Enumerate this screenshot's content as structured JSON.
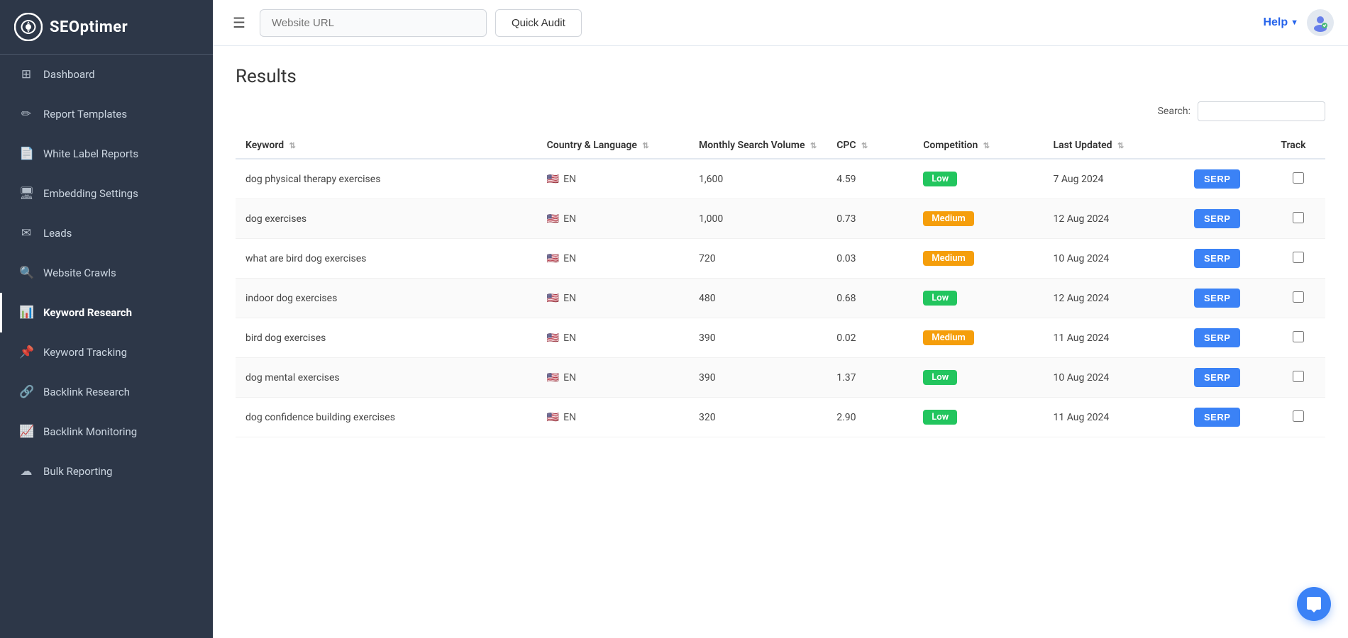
{
  "sidebar": {
    "logo_text": "SEOptimer",
    "items": [
      {
        "id": "dashboard",
        "label": "Dashboard",
        "icon": "⊞",
        "active": false
      },
      {
        "id": "report-templates",
        "label": "Report Templates",
        "icon": "✏",
        "active": false
      },
      {
        "id": "white-label-reports",
        "label": "White Label Reports",
        "icon": "📄",
        "active": false
      },
      {
        "id": "embedding-settings",
        "label": "Embedding Settings",
        "icon": "🖥",
        "active": false
      },
      {
        "id": "leads",
        "label": "Leads",
        "icon": "✉",
        "active": false
      },
      {
        "id": "website-crawls",
        "label": "Website Crawls",
        "icon": "🔍",
        "active": false
      },
      {
        "id": "keyword-research",
        "label": "Keyword Research",
        "icon": "📊",
        "active": true
      },
      {
        "id": "keyword-tracking",
        "label": "Keyword Tracking",
        "icon": "📌",
        "active": false
      },
      {
        "id": "backlink-research",
        "label": "Backlink Research",
        "icon": "🔗",
        "active": false
      },
      {
        "id": "backlink-monitoring",
        "label": "Backlink Monitoring",
        "icon": "📈",
        "active": false
      },
      {
        "id": "bulk-reporting",
        "label": "Bulk Reporting",
        "icon": "☁",
        "active": false
      }
    ]
  },
  "topbar": {
    "url_placeholder": "Website URL",
    "quick_audit_label": "Quick Audit",
    "help_label": "Help",
    "help_chevron": "▼"
  },
  "content": {
    "results_title": "Results",
    "search_label": "Search:",
    "search_placeholder": "",
    "table": {
      "columns": [
        {
          "id": "keyword",
          "label": "Keyword",
          "sortable": true
        },
        {
          "id": "country",
          "label": "Country & Language",
          "sortable": true
        },
        {
          "id": "volume",
          "label": "Monthly Search Volume",
          "sortable": true
        },
        {
          "id": "cpc",
          "label": "CPC",
          "sortable": true
        },
        {
          "id": "competition",
          "label": "Competition",
          "sortable": true
        },
        {
          "id": "updated",
          "label": "Last Updated",
          "sortable": true
        },
        {
          "id": "serp",
          "label": "",
          "sortable": false
        },
        {
          "id": "track",
          "label": "Track",
          "sortable": false
        }
      ],
      "rows": [
        {
          "keyword": "dog physical therapy exercises",
          "country": "EN",
          "volume": "1,600",
          "cpc": "4.59",
          "competition": "Low",
          "competition_level": "low",
          "updated": "7 Aug 2024"
        },
        {
          "keyword": "dog exercises",
          "country": "EN",
          "volume": "1,000",
          "cpc": "0.73",
          "competition": "Medium",
          "competition_level": "medium",
          "updated": "12 Aug 2024"
        },
        {
          "keyword": "what are bird dog exercises",
          "country": "EN",
          "volume": "720",
          "cpc": "0.03",
          "competition": "Medium",
          "competition_level": "medium",
          "updated": "10 Aug 2024"
        },
        {
          "keyword": "indoor dog exercises",
          "country": "EN",
          "volume": "480",
          "cpc": "0.68",
          "competition": "Low",
          "competition_level": "low",
          "updated": "12 Aug 2024"
        },
        {
          "keyword": "bird dog exercises",
          "country": "EN",
          "volume": "390",
          "cpc": "0.02",
          "competition": "Medium",
          "competition_level": "medium",
          "updated": "11 Aug 2024"
        },
        {
          "keyword": "dog mental exercises",
          "country": "EN",
          "volume": "390",
          "cpc": "1.37",
          "competition": "Low",
          "competition_level": "low",
          "updated": "10 Aug 2024"
        },
        {
          "keyword": "dog confidence building exercises",
          "country": "EN",
          "volume": "320",
          "cpc": "2.90",
          "competition": "Low",
          "competition_level": "low",
          "updated": "11 Aug 2024"
        }
      ],
      "serp_button_label": "SERP"
    }
  }
}
